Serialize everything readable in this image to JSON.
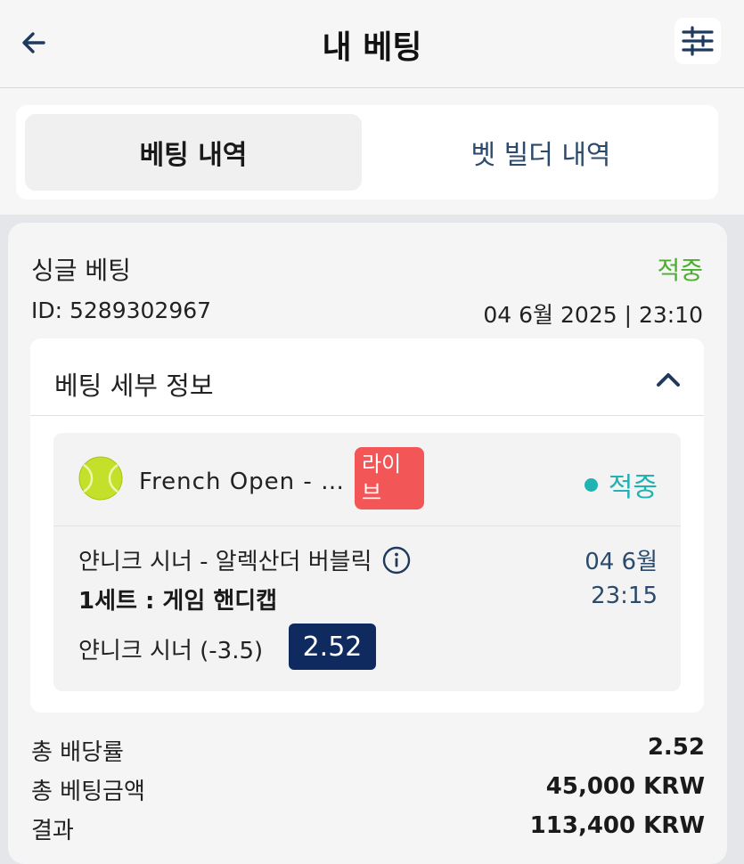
{
  "header": {
    "title": "내 베팅",
    "back_icon": "arrow-left-icon",
    "filter_icon": "sliders-icon"
  },
  "tabs": [
    {
      "label": "베팅 내역",
      "active": true
    },
    {
      "label": "벳 빌더 내역",
      "active": false
    }
  ],
  "bet": {
    "type": "싱글 베팅",
    "status": "적중",
    "id": "ID: 5289302967",
    "date": "04 6월 2025 | 23:10",
    "details_title": "베팅 세부 정보",
    "selection": {
      "event": "French Open - …",
      "live_badge": "라이브",
      "status": "적중",
      "match": "얀니크 시너 - 알렉산더 버블릭",
      "match_date": "04 6월",
      "market": "1세트 : 게임 핸디캡",
      "match_time": "23:15",
      "pick": "얀니크 시너 (-3.5)",
      "odds": "2.52"
    },
    "summary": [
      {
        "label": "총 배당률",
        "value": "2.52"
      },
      {
        "label": "총 베팅금액",
        "value": "45,000 KRW"
      },
      {
        "label": "결과",
        "value": "113,400 KRW"
      }
    ]
  },
  "colors": {
    "win_green": "#4caf2f",
    "selection_status": "#1fb3b3",
    "live_red": "#f35656",
    "odds_navy": "#0f2a5e",
    "link_blue": "#2c4a6b"
  }
}
